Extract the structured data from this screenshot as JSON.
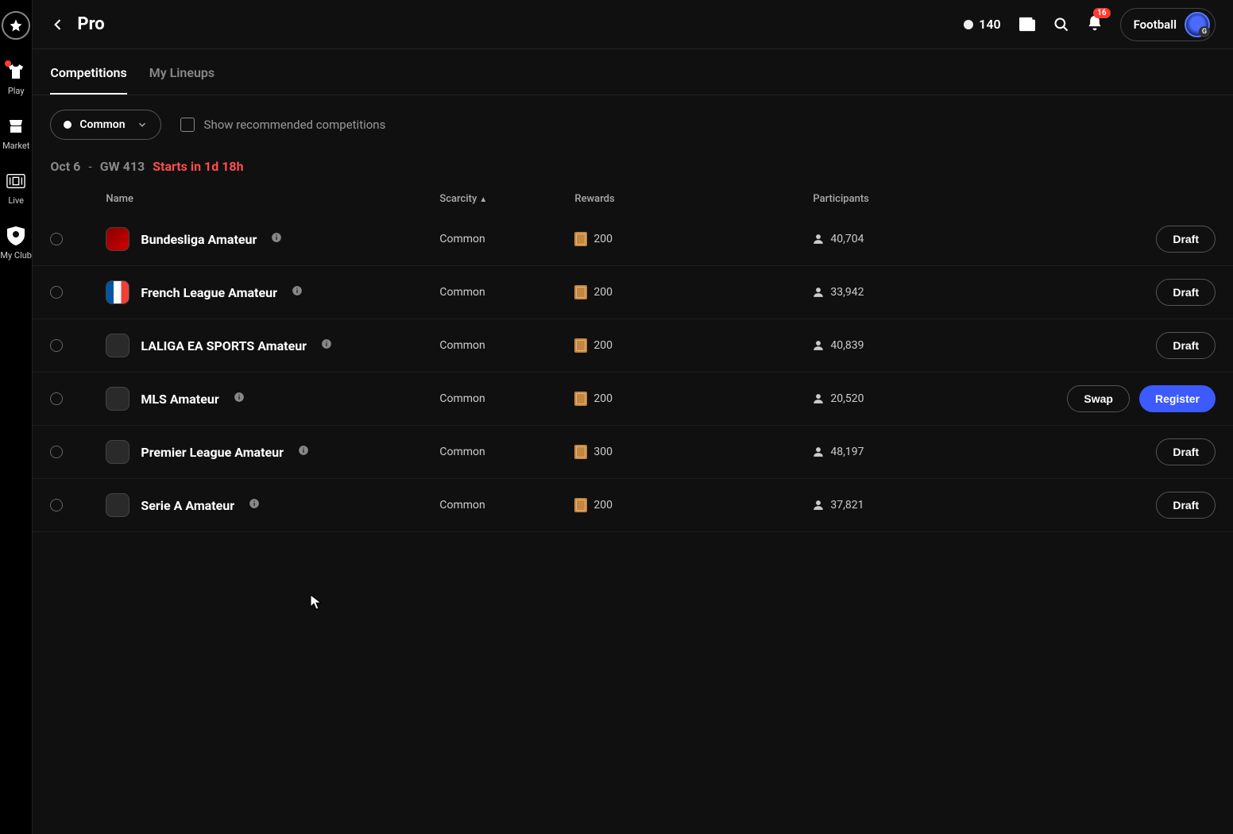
{
  "sidebar": {
    "items": [
      {
        "label": "Play"
      },
      {
        "label": "Market"
      },
      {
        "label": "Live"
      },
      {
        "label": "My Club"
      }
    ]
  },
  "header": {
    "title": "Pro",
    "coins": "140",
    "notif_count": "16",
    "sport": "Football"
  },
  "tabs": {
    "competitions": "Competitions",
    "lineups": "My Lineups"
  },
  "filter": {
    "scarcity": "Common",
    "checkbox_label": "Show recommended competitions"
  },
  "gw": {
    "date": "Oct 6",
    "dash": "-",
    "num": "GW 413",
    "start": "Starts in 1d 18h"
  },
  "columns": {
    "name": "Name",
    "scarcity": "Scarcity",
    "rewards": "Rewards",
    "participants": "Participants"
  },
  "rows": [
    {
      "name": "Bundesliga Amateur",
      "scarcity": "Common",
      "rewards": "200",
      "participants": "40,704",
      "actions": [
        {
          "label": "Draft",
          "style": "outline"
        }
      ],
      "badge": "red"
    },
    {
      "name": "French League Amateur",
      "scarcity": "Common",
      "rewards": "200",
      "participants": "33,942",
      "actions": [
        {
          "label": "Draft",
          "style": "outline"
        }
      ],
      "badge": "fr"
    },
    {
      "name": "LALIGA EA SPORTS Amateur",
      "scarcity": "Common",
      "rewards": "200",
      "participants": "40,839",
      "actions": [
        {
          "label": "Draft",
          "style": "outline"
        }
      ],
      "badge": "dark"
    },
    {
      "name": "MLS Amateur",
      "scarcity": "Common",
      "rewards": "200",
      "participants": "20,520",
      "actions": [
        {
          "label": "Swap",
          "style": "outline"
        },
        {
          "label": "Register",
          "style": "primary"
        }
      ],
      "badge": "dark"
    },
    {
      "name": "Premier League Amateur",
      "scarcity": "Common",
      "rewards": "300",
      "participants": "48,197",
      "actions": [
        {
          "label": "Draft",
          "style": "outline"
        }
      ],
      "badge": "dark"
    },
    {
      "name": "Serie A Amateur",
      "scarcity": "Common",
      "rewards": "200",
      "participants": "37,821",
      "actions": [
        {
          "label": "Draft",
          "style": "outline"
        }
      ],
      "badge": "dark"
    }
  ]
}
